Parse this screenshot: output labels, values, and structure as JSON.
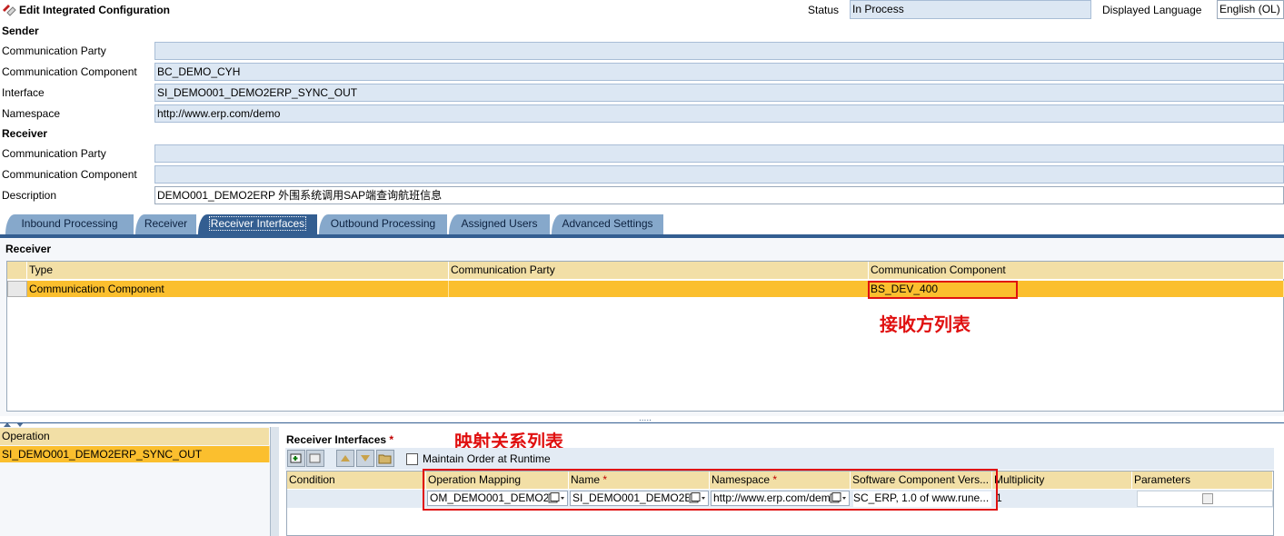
{
  "header": {
    "title": "Edit Integrated Configuration",
    "status_label": "Status",
    "status_value": "In Process",
    "language_label": "Displayed Language",
    "language_value": "English (OL)"
  },
  "sender": {
    "section_title": "Sender",
    "party_label": "Communication Party",
    "party_value": "",
    "component_label": "Communication Component",
    "component_value": "BC_DEMO_CYH",
    "interface_label": "Interface",
    "interface_value": "SI_DEMO001_DEMO2ERP_SYNC_OUT",
    "namespace_label": "Namespace",
    "namespace_value": "http://www.erp.com/demo"
  },
  "receiver": {
    "section_title": "Receiver",
    "party_label": "Communication Party",
    "party_value": "",
    "component_label": "Communication Component",
    "component_value": "",
    "description_label": "Description",
    "description_value": "DEMO001_DEMO2ERP 外围系统调用SAP端查询航班信息"
  },
  "tabs": [
    {
      "label": "Inbound Processing"
    },
    {
      "label": "Receiver"
    },
    {
      "label": "Receiver Interfaces"
    },
    {
      "label": "Outbound Processing"
    },
    {
      "label": "Assigned Users"
    },
    {
      "label": "Advanced Settings"
    }
  ],
  "receiver_table": {
    "title": "Receiver",
    "columns": [
      "Type",
      "Communication Party",
      "Communication Component"
    ],
    "rows": [
      {
        "type": "Communication Component",
        "party": "",
        "component": "BS_DEV_400"
      }
    ],
    "annotation": "接收方列表"
  },
  "operation_panel": {
    "header": "Operation",
    "rows": [
      "SI_DEMO001_DEMO2ERP_SYNC_OUT"
    ]
  },
  "receiver_interfaces": {
    "title": "Receiver Interfaces",
    "required_mark": "*",
    "annotation": "映射关系列表",
    "maintain_order_label": "Maintain Order at Runtime",
    "columns": [
      "Condition",
      "Operation Mapping",
      "Name",
      "Namespace",
      "Software Component Vers...",
      "Multiplicity",
      "Parameters"
    ],
    "rows": [
      {
        "condition": "",
        "operation_mapping": "OM_DEMO001_DEMO2",
        "name": "SI_DEMO001_DEMO2E",
        "namespace": "http://www.erp.com/dem",
        "software_component": "SC_ERP, 1.0 of www.rune...",
        "multiplicity": "1"
      }
    ]
  },
  "splitter_handle": "....."
}
